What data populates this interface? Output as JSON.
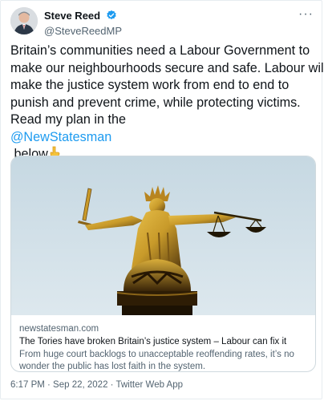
{
  "author": {
    "display_name": "Steve Reed",
    "handle": "@SteveReedMP",
    "verified_icon": "verified-badge-icon",
    "more_icon": "more-options-icon"
  },
  "tweet": {
    "lines": [
      "Britain’s communities need a Labour Government to",
      "make our neighbourhoods secure and safe. Labour will",
      "make the justice system work from end to end to",
      "punish and prevent crime, while protecting victims.",
      "Read my plan in the"
    ],
    "mention": "@NewStatesman",
    "tail": " below",
    "emoji_icon": "pointing-down-hand-icon"
  },
  "link_card": {
    "image_icon": "lady-justice-statue-image",
    "domain": "newstatesman.com",
    "headline": "The Tories have broken Britain’s justice system – Labour can fix it",
    "description": "From huge court backlogs to unacceptable reoffending rates, it’s no wonder the public has lost faith in the system."
  },
  "meta": {
    "timestamp": "6:17 PM · Sep 22, 2022 · Twitter Web App"
  },
  "colors": {
    "link_blue": "#1d9bf0",
    "secondary_text": "#536471",
    "sky_top": "#c6d8e2",
    "statue_gold": "#c89a2a"
  }
}
